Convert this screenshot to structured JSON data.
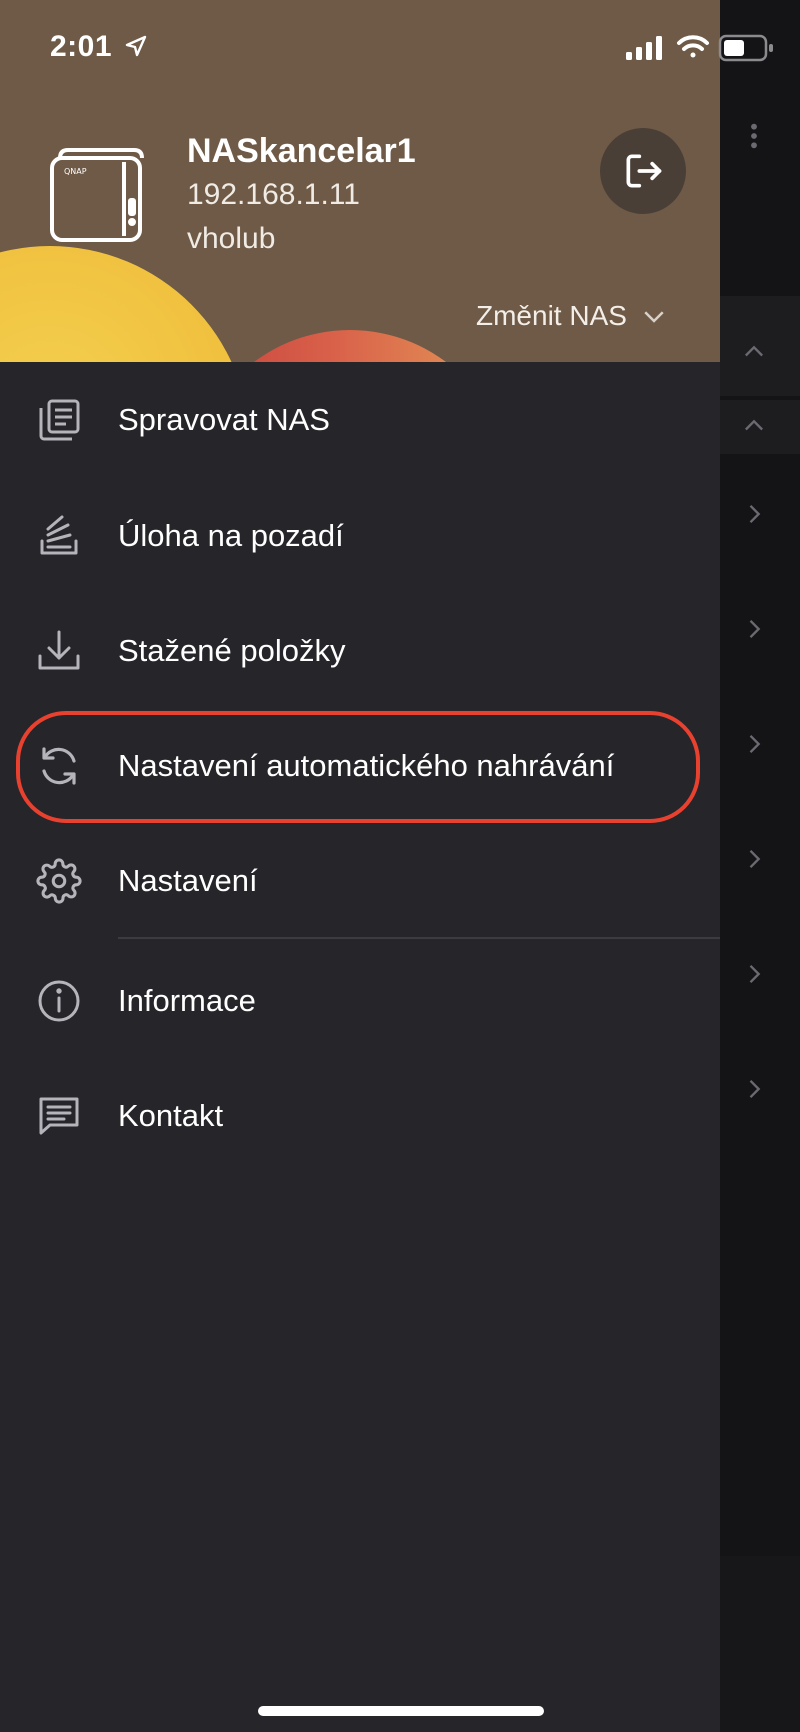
{
  "status_bar": {
    "time": "2:01"
  },
  "header": {
    "nas_name": "NASkancelar1",
    "nas_ip": "192.168.1.11",
    "username": "vholub",
    "change_nas_label": "Změnit NAS"
  },
  "menu": {
    "items": [
      {
        "label": "Spravovat NAS",
        "icon": "manage-nas-icon"
      },
      {
        "label": "Úloha na pozadí",
        "icon": "background-task-icon"
      },
      {
        "label": "Stažené položky",
        "icon": "download-icon"
      },
      {
        "label": "Nastavení automatického nahrávání",
        "icon": "sync-icon"
      },
      {
        "label": "Nastavení",
        "icon": "gear-icon"
      },
      {
        "label": "Informace",
        "icon": "info-icon"
      },
      {
        "label": "Kontakt",
        "icon": "message-icon"
      }
    ]
  },
  "colors": {
    "header_bg": "#6e5a46",
    "drawer_bg": "#25252a",
    "highlight": "#e8412f"
  }
}
